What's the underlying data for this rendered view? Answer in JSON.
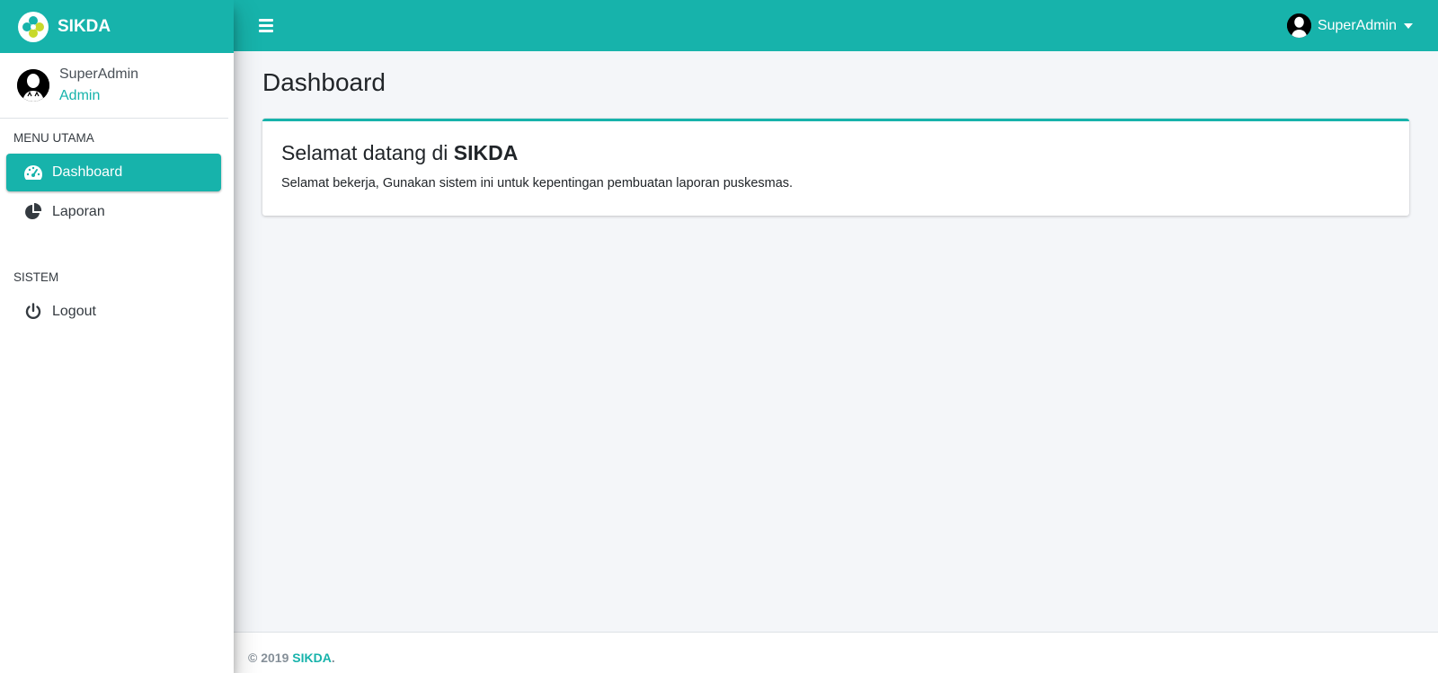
{
  "brand": {
    "name": "SIKDA"
  },
  "user_panel": {
    "name": "SuperAdmin",
    "role": "Admin"
  },
  "sidebar": {
    "sections": [
      {
        "header": "MENU UTAMA"
      },
      {
        "header": "SISTEM"
      }
    ],
    "items": [
      {
        "label": "Dashboard",
        "icon": "tachometer-icon",
        "active": true
      },
      {
        "label": "Laporan",
        "icon": "pie-chart-icon",
        "active": false
      },
      {
        "label": "Logout",
        "icon": "power-icon",
        "active": false
      }
    ]
  },
  "navbar": {
    "user_name": "SuperAdmin"
  },
  "page": {
    "title": "Dashboard",
    "card": {
      "title_prefix": "Selamat datang di",
      "title_brand": "SIKDA",
      "text": "Selamat bekerja, Gunakan sistem ini untuk kepentingan pembuatan laporan puskesmas."
    }
  },
  "footer": {
    "copyright": "© 2019",
    "brand": "SIKDA",
    "suffix": "."
  },
  "colors": {
    "primary": "#17b3ab",
    "sidebar_bg": "#ffffff",
    "content_bg": "#f4f6f9"
  }
}
